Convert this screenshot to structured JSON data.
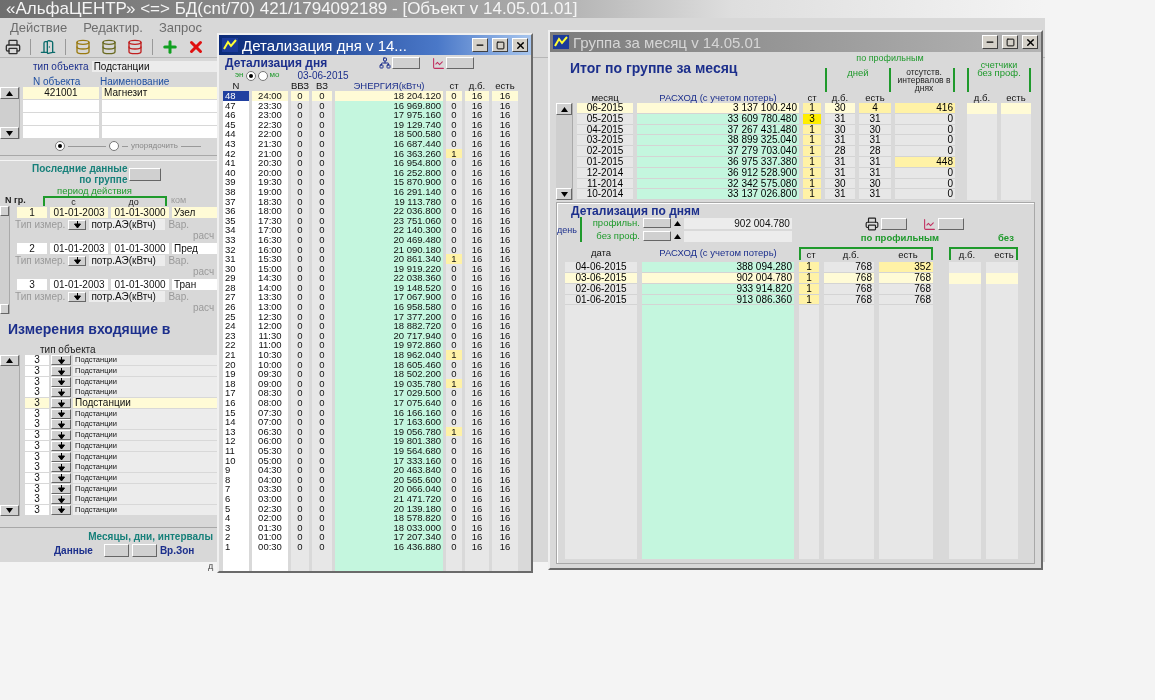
{
  "app": {
    "title": "«АльфаЦЕНТР» <=> БД(cnt/70) 421/1794092189 - [Объект  v 14.05.01.01]",
    "menu": [
      "Действие",
      "Редактир.",
      "Запрос"
    ],
    "object_type_label": "тип объекта",
    "object_type": "Подстанции",
    "object_columns": [
      "N объекта",
      "Наименование"
    ],
    "objects": [
      {
        "number": "421001",
        "name": "Магнезит",
        "selected": true
      }
    ],
    "order_radios": [
      {
        "selected": true
      },
      {
        "selected": false
      }
    ],
    "order_label": "упорядочить",
    "last_data": [
      "Последние данные",
      "по группе"
    ],
    "period_label": "период действия",
    "group_columns": [
      "N гр.",
      "с",
      "до",
      "ком"
    ],
    "groups": [
      {
        "number": "1",
        "from": "01-01-2003",
        "to": "01-01-3000",
        "comment": "Узел",
        "selected": true,
        "measure_label": "Тип измер.",
        "measure": "потр.АЭ(кВтч)",
        "var": "Вар.",
        "calc": "расч"
      },
      {
        "number": "2",
        "from": "01-01-2003",
        "to": "01-01-3000",
        "comment": "Пред",
        "selected": false,
        "measure_label": "Тип измер.",
        "measure": "потр.АЭ(кВтч)",
        "var": "Вар.",
        "calc": "расч"
      },
      {
        "number": "3",
        "from": "01-01-2003",
        "to": "01-01-3000",
        "comment": "Тран",
        "selected": false,
        "measure_label": "Тип измер.",
        "measure": "потр.АЭ(кВтч)",
        "var": "Вар.",
        "calc": "расч"
      }
    ],
    "measurements_title": "Измерения входящие в",
    "measure_type_label": "тип объекта",
    "measurements": [
      {
        "n": "3",
        "type": "Подстанции",
        "selected": false
      },
      {
        "n": "3",
        "type": "Подстанции",
        "selected": false
      },
      {
        "n": "3",
        "type": "Подстанции",
        "selected": false
      },
      {
        "n": "3",
        "type": "Подстанции",
        "selected": false
      },
      {
        "n": "3",
        "type": "Подстанции",
        "selected": true
      },
      {
        "n": "3",
        "type": "Подстанции",
        "selected": false
      },
      {
        "n": "3",
        "type": "Подстанции",
        "selected": false
      },
      {
        "n": "3",
        "type": "Подстанции",
        "selected": false
      },
      {
        "n": "3",
        "type": "Подстанции",
        "selected": false
      },
      {
        "n": "3",
        "type": "Подстанции",
        "selected": false
      },
      {
        "n": "3",
        "type": "Подстанции",
        "selected": false
      },
      {
        "n": "3",
        "type": "Подстанции",
        "selected": false
      },
      {
        "n": "3",
        "type": "Подстанции",
        "selected": false
      },
      {
        "n": "3",
        "type": "Подстанции",
        "selected": false
      },
      {
        "n": "3",
        "type": "Подстанции",
        "selected": false
      }
    ],
    "footer_title": "Месяцы, дни, интервалы",
    "data_label": "Данные",
    "zones_label": "Вр.Зон",
    "footer_note": "д"
  },
  "day_window": {
    "title": "Детализация дня  v 14...",
    "heading": "Детализация дня",
    "modes": [
      {
        "label": "эн",
        "selected": true
      },
      {
        "label": "мо",
        "selected": false
      }
    ],
    "date": "03-06-2015",
    "columns": {
      "n": "N",
      "vvz": "ВВЗ",
      "vz": "ВЗ",
      "energy": "ЭНЕРГИЯ(кВтч)",
      "st": "ст",
      "db": "д.б.",
      "est": "есть"
    },
    "rows": [
      {
        "cells": [
          "48",
          "24:00",
          "0",
          "0",
          "18 204.120",
          "0",
          "16",
          "16"
        ],
        "flagged": false,
        "selected": true
      },
      {
        "cells": [
          "47",
          "23:30",
          "0",
          "0",
          "16 969.800",
          "0",
          "16",
          "16"
        ],
        "flagged": false,
        "selected": false
      },
      {
        "cells": [
          "46",
          "23:00",
          "0",
          "0",
          "17 975.160",
          "0",
          "16",
          "16"
        ],
        "flagged": false,
        "selected": false
      },
      {
        "cells": [
          "45",
          "22:30",
          "0",
          "0",
          "19 129.740",
          "0",
          "16",
          "16"
        ],
        "flagged": false,
        "selected": false
      },
      {
        "cells": [
          "44",
          "22:00",
          "0",
          "0",
          "18 500.580",
          "0",
          "16",
          "16"
        ],
        "flagged": false,
        "selected": false
      },
      {
        "cells": [
          "43",
          "21:30",
          "0",
          "0",
          "16 687.440",
          "0",
          "16",
          "16"
        ],
        "flagged": false,
        "selected": false
      },
      {
        "cells": [
          "42",
          "21:00",
          "0",
          "0",
          "16 363.260",
          "1",
          "16",
          "16"
        ],
        "flagged": true,
        "selected": false
      },
      {
        "cells": [
          "41",
          "20:30",
          "0",
          "0",
          "16 954.800",
          "0",
          "16",
          "16"
        ],
        "flagged": false,
        "selected": false
      },
      {
        "cells": [
          "40",
          "20:00",
          "0",
          "0",
          "16 252.800",
          "0",
          "16",
          "16"
        ],
        "flagged": false,
        "selected": false
      },
      {
        "cells": [
          "39",
          "19:30",
          "0",
          "0",
          "15 870.900",
          "0",
          "16",
          "16"
        ],
        "flagged": false,
        "selected": false
      },
      {
        "cells": [
          "38",
          "19:00",
          "0",
          "0",
          "16 291.140",
          "0",
          "16",
          "16"
        ],
        "flagged": false,
        "selected": false
      },
      {
        "cells": [
          "37",
          "18:30",
          "0",
          "0",
          "19 113.780",
          "0",
          "16",
          "16"
        ],
        "flagged": false,
        "selected": false
      },
      {
        "cells": [
          "36",
          "18:00",
          "0",
          "0",
          "22 036.800",
          "0",
          "16",
          "16"
        ],
        "flagged": false,
        "selected": false
      },
      {
        "cells": [
          "35",
          "17:30",
          "0",
          "0",
          "23 751.060",
          "0",
          "16",
          "16"
        ],
        "flagged": false,
        "selected": false
      },
      {
        "cells": [
          "34",
          "17:00",
          "0",
          "0",
          "22 140.300",
          "0",
          "16",
          "16"
        ],
        "flagged": false,
        "selected": false
      },
      {
        "cells": [
          "33",
          "16:30",
          "0",
          "0",
          "20 469.480",
          "0",
          "16",
          "16"
        ],
        "flagged": false,
        "selected": false
      },
      {
        "cells": [
          "32",
          "16:00",
          "0",
          "0",
          "21 090.180",
          "0",
          "16",
          "16"
        ],
        "flagged": false,
        "selected": false
      },
      {
        "cells": [
          "31",
          "15:30",
          "0",
          "0",
          "20 861.340",
          "1",
          "16",
          "16"
        ],
        "flagged": true,
        "selected": false
      },
      {
        "cells": [
          "30",
          "15:00",
          "0",
          "0",
          "19 919.220",
          "0",
          "16",
          "16"
        ],
        "flagged": false,
        "selected": false
      },
      {
        "cells": [
          "29",
          "14:30",
          "0",
          "0",
          "22 038.360",
          "0",
          "16",
          "16"
        ],
        "flagged": false,
        "selected": false
      },
      {
        "cells": [
          "28",
          "14:00",
          "0",
          "0",
          "19 148.520",
          "0",
          "16",
          "16"
        ],
        "flagged": false,
        "selected": false
      },
      {
        "cells": [
          "27",
          "13:30",
          "0",
          "0",
          "17 067.900",
          "0",
          "16",
          "16"
        ],
        "flagged": false,
        "selected": false
      },
      {
        "cells": [
          "26",
          "13:00",
          "0",
          "0",
          "16 958.580",
          "0",
          "16",
          "16"
        ],
        "flagged": false,
        "selected": false
      },
      {
        "cells": [
          "25",
          "12:30",
          "0",
          "0",
          "17 377.200",
          "0",
          "16",
          "16"
        ],
        "flagged": false,
        "selected": false
      },
      {
        "cells": [
          "24",
          "12:00",
          "0",
          "0",
          "18 882.720",
          "0",
          "16",
          "16"
        ],
        "flagged": false,
        "selected": false
      },
      {
        "cells": [
          "23",
          "11:30",
          "0",
          "0",
          "20 717.940",
          "0",
          "16",
          "16"
        ],
        "flagged": false,
        "selected": false
      },
      {
        "cells": [
          "22",
          "11:00",
          "0",
          "0",
          "19 972.860",
          "0",
          "16",
          "16"
        ],
        "flagged": false,
        "selected": false
      },
      {
        "cells": [
          "21",
          "10:30",
          "0",
          "0",
          "18 962.040",
          "1",
          "16",
          "16"
        ],
        "flagged": true,
        "selected": false
      },
      {
        "cells": [
          "20",
          "10:00",
          "0",
          "0",
          "18 605.460",
          "0",
          "16",
          "16"
        ],
        "flagged": false,
        "selected": false
      },
      {
        "cells": [
          "19",
          "09:30",
          "0",
          "0",
          "18 502.200",
          "0",
          "16",
          "16"
        ],
        "flagged": false,
        "selected": false
      },
      {
        "cells": [
          "18",
          "09:00",
          "0",
          "0",
          "19 035.780",
          "1",
          "16",
          "16"
        ],
        "flagged": true,
        "selected": false
      },
      {
        "cells": [
          "17",
          "08:30",
          "0",
          "0",
          "17 029.500",
          "0",
          "16",
          "16"
        ],
        "flagged": false,
        "selected": false
      },
      {
        "cells": [
          "16",
          "08:00",
          "0",
          "0",
          "17 075.640",
          "0",
          "16",
          "16"
        ],
        "flagged": false,
        "selected": false
      },
      {
        "cells": [
          "15",
          "07:30",
          "0",
          "0",
          "16 166.160",
          "0",
          "16",
          "16"
        ],
        "flagged": false,
        "selected": false
      },
      {
        "cells": [
          "14",
          "07:00",
          "0",
          "0",
          "17 163.600",
          "0",
          "16",
          "16"
        ],
        "flagged": false,
        "selected": false
      },
      {
        "cells": [
          "13",
          "06:30",
          "0",
          "0",
          "19 056.780",
          "1",
          "16",
          "16"
        ],
        "flagged": true,
        "selected": false
      },
      {
        "cells": [
          "12",
          "06:00",
          "0",
          "0",
          "19 801.380",
          "0",
          "16",
          "16"
        ],
        "flagged": false,
        "selected": false
      },
      {
        "cells": [
          "11",
          "05:30",
          "0",
          "0",
          "19 564.680",
          "0",
          "16",
          "16"
        ],
        "flagged": false,
        "selected": false
      },
      {
        "cells": [
          "10",
          "05:00",
          "0",
          "0",
          "17 333.160",
          "0",
          "16",
          "16"
        ],
        "flagged": false,
        "selected": false
      },
      {
        "cells": [
          "9",
          "04:30",
          "0",
          "0",
          "20 463.840",
          "0",
          "16",
          "16"
        ],
        "flagged": false,
        "selected": false
      },
      {
        "cells": [
          "8",
          "04:00",
          "0",
          "0",
          "20 565.600",
          "0",
          "16",
          "16"
        ],
        "flagged": false,
        "selected": false
      },
      {
        "cells": [
          "7",
          "03:30",
          "0",
          "0",
          "20 066.040",
          "0",
          "16",
          "16"
        ],
        "flagged": false,
        "selected": false
      },
      {
        "cells": [
          "6",
          "03:00",
          "0",
          "0",
          "21 471.720",
          "0",
          "16",
          "16"
        ],
        "flagged": false,
        "selected": false
      },
      {
        "cells": [
          "5",
          "02:30",
          "0",
          "0",
          "20 139.180",
          "0",
          "16",
          "16"
        ],
        "flagged": false,
        "selected": false
      },
      {
        "cells": [
          "4",
          "02:00",
          "0",
          "0",
          "18 578.820",
          "0",
          "16",
          "16"
        ],
        "flagged": false,
        "selected": false
      },
      {
        "cells": [
          "3",
          "01:30",
          "0",
          "0",
          "18 033.000",
          "0",
          "16",
          "16"
        ],
        "flagged": false,
        "selected": false
      },
      {
        "cells": [
          "2",
          "01:00",
          "0",
          "0",
          "17 207.340",
          "0",
          "16",
          "16"
        ],
        "flagged": false,
        "selected": false
      },
      {
        "cells": [
          "1",
          "00:30",
          "0",
          "0",
          "16 436.880",
          "0",
          "16",
          "16"
        ],
        "flagged": false,
        "selected": false
      }
    ]
  },
  "month_window": {
    "title": "Группа за месяц   v 14.05.01",
    "heading": "Итог по группе за месяц",
    "group_profile": "по профильным",
    "group_days": "дней",
    "group_missing": "отсутств. интервалов в днях",
    "group_meters": "счетчики",
    "group_noprof": "без проф.",
    "columns": [
      "месяц",
      "РАСХОД (с учетом потерь)",
      "ст",
      "д.б.",
      "есть",
      "д.б.",
      "есть"
    ],
    "rows": [
      {
        "cells": [
          "06-2015",
          "3 137 100.240",
          "1",
          "30",
          "4",
          "416"
        ],
        "selected": true,
        "alert": false,
        "short": true,
        "gap": true
      },
      {
        "cells": [
          "05-2015",
          "33 609 780.480",
          "3",
          "31",
          "31",
          "0"
        ],
        "selected": false,
        "alert": true,
        "short": false,
        "gap": false
      },
      {
        "cells": [
          "04-2015",
          "37 267 431.480",
          "1",
          "30",
          "30",
          "0"
        ],
        "selected": false,
        "alert": false,
        "short": false,
        "gap": false
      },
      {
        "cells": [
          "03-2015",
          "38 899 325.040",
          "1",
          "31",
          "31",
          "0"
        ],
        "selected": false,
        "alert": false,
        "short": false,
        "gap": false
      },
      {
        "cells": [
          "02-2015",
          "37 279 703.040",
          "1",
          "28",
          "28",
          "0"
        ],
        "selected": false,
        "alert": false,
        "short": false,
        "gap": false
      },
      {
        "cells": [
          "01-2015",
          "36 975 337.380",
          "1",
          "31",
          "31",
          "448"
        ],
        "selected": false,
        "alert": false,
        "short": false,
        "gap": true
      },
      {
        "cells": [
          "12-2014",
          "36 912 528.900",
          "1",
          "31",
          "31",
          "0"
        ],
        "selected": false,
        "alert": false,
        "short": false,
        "gap": false
      },
      {
        "cells": [
          "11-2014",
          "32 342 575.080",
          "1",
          "30",
          "30",
          "0"
        ],
        "selected": false,
        "alert": false,
        "short": false,
        "gap": false
      },
      {
        "cells": [
          "10-2014",
          "33 137 026.800",
          "1",
          "31",
          "31",
          "0"
        ],
        "selected": false,
        "alert": false,
        "short": false,
        "gap": false
      }
    ],
    "daily": {
      "title": "Детализация по дням",
      "day_label": "день",
      "profile_label": "профильн.",
      "profile_value": "902 004.780",
      "noprof_label": "без проф.",
      "group_profile": "по профильным",
      "group_noprof": "без",
      "columns": [
        "дата",
        "РАСХОД (с учетом потерь)",
        "ст",
        "д.б.",
        "есть",
        "д.б.",
        "есть"
      ],
      "rows": [
        {
          "cells": [
            "04-06-2015",
            "388 094.280",
            "1",
            "768",
            "352"
          ],
          "selected": false,
          "short": true
        },
        {
          "cells": [
            "03-06-2015",
            "902 004.780",
            "1",
            "768",
            "768"
          ],
          "selected": true,
          "short": false
        },
        {
          "cells": [
            "02-06-2015",
            "933 914.820",
            "1",
            "768",
            "768"
          ],
          "selected": false,
          "short": false
        },
        {
          "cells": [
            "01-06-2015",
            "913 086.360",
            "1",
            "768",
            "768"
          ],
          "selected": false,
          "short": false
        }
      ]
    }
  }
}
